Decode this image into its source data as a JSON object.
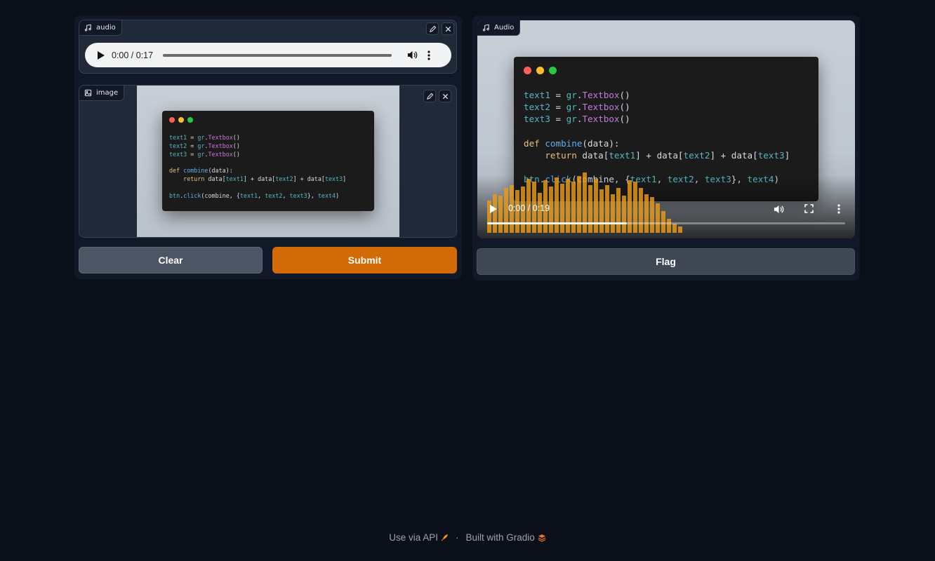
{
  "input_panel": {
    "audio": {
      "label": "audio",
      "time": "0:00 / 0:17"
    },
    "image": {
      "label": "image",
      "code_lines": [
        [
          {
            "t": "text1",
            "c": "var"
          },
          {
            "t": " = ",
            "c": "txt"
          },
          {
            "t": "gr",
            "c": "var"
          },
          {
            "t": ".",
            "c": "txt"
          },
          {
            "t": "Textbox",
            "c": "cls"
          },
          {
            "t": "()",
            "c": "txt"
          }
        ],
        [
          {
            "t": "text2",
            "c": "var"
          },
          {
            "t": " = ",
            "c": "txt"
          },
          {
            "t": "gr",
            "c": "var"
          },
          {
            "t": ".",
            "c": "txt"
          },
          {
            "t": "Textbox",
            "c": "cls"
          },
          {
            "t": "()",
            "c": "txt"
          }
        ],
        [
          {
            "t": "text3",
            "c": "var"
          },
          {
            "t": " = ",
            "c": "txt"
          },
          {
            "t": "gr",
            "c": "var"
          },
          {
            "t": ".",
            "c": "txt"
          },
          {
            "t": "Textbox",
            "c": "cls"
          },
          {
            "t": "()",
            "c": "txt"
          }
        ],
        [],
        [
          {
            "t": "def ",
            "c": "kw"
          },
          {
            "t": "combine",
            "c": "fn"
          },
          {
            "t": "(data):",
            "c": "txt"
          }
        ],
        [
          {
            "t": "    return ",
            "c": "kw"
          },
          {
            "t": "data[",
            "c": "txt"
          },
          {
            "t": "text1",
            "c": "var"
          },
          {
            "t": "] + ",
            "c": "txt"
          },
          {
            "t": "data[",
            "c": "txt"
          },
          {
            "t": "text2",
            "c": "var"
          },
          {
            "t": "] + ",
            "c": "txt"
          },
          {
            "t": "data[",
            "c": "txt"
          },
          {
            "t": "text3",
            "c": "var"
          },
          {
            "t": "]",
            "c": "txt"
          }
        ],
        [],
        [
          {
            "t": "btn",
            "c": "var"
          },
          {
            "t": ".",
            "c": "txt"
          },
          {
            "t": "click",
            "c": "fn"
          },
          {
            "t": "(combine, {",
            "c": "txt"
          },
          {
            "t": "text1",
            "c": "var"
          },
          {
            "t": ", ",
            "c": "txt"
          },
          {
            "t": "text2",
            "c": "var"
          },
          {
            "t": ", ",
            "c": "txt"
          },
          {
            "t": "text3",
            "c": "var"
          },
          {
            "t": "}, ",
            "c": "txt"
          },
          {
            "t": "text4",
            "c": "var"
          },
          {
            "t": ")",
            "c": "txt"
          }
        ]
      ]
    },
    "clear_label": "Clear",
    "submit_label": "Submit"
  },
  "output_panel": {
    "label": "Audio",
    "video_time": "0:00 / 0:19",
    "video_progress": 0.39,
    "code_lines": [
      [
        {
          "t": "text1",
          "c": "var"
        },
        {
          "t": " = ",
          "c": "txt"
        },
        {
          "t": "gr",
          "c": "var"
        },
        {
          "t": ".",
          "c": "txt"
        },
        {
          "t": "Textbox",
          "c": "cls"
        },
        {
          "t": "()",
          "c": "txt"
        }
      ],
      [
        {
          "t": "text2",
          "c": "var"
        },
        {
          "t": " = ",
          "c": "txt"
        },
        {
          "t": "gr",
          "c": "var"
        },
        {
          "t": ".",
          "c": "txt"
        },
        {
          "t": "Textbox",
          "c": "cls"
        },
        {
          "t": "()",
          "c": "txt"
        }
      ],
      [
        {
          "t": "text3",
          "c": "var"
        },
        {
          "t": " = ",
          "c": "txt"
        },
        {
          "t": "gr",
          "c": "var"
        },
        {
          "t": ".",
          "c": "txt"
        },
        {
          "t": "Textbox",
          "c": "cls"
        },
        {
          "t": "()",
          "c": "txt"
        }
      ],
      [],
      [
        {
          "t": "def ",
          "c": "kw"
        },
        {
          "t": "combine",
          "c": "fn"
        },
        {
          "t": "(data):",
          "c": "txt"
        }
      ],
      [
        {
          "t": "    return ",
          "c": "kw"
        },
        {
          "t": "data[",
          "c": "txt"
        },
        {
          "t": "text1",
          "c": "var"
        },
        {
          "t": "] + ",
          "c": "txt"
        },
        {
          "t": "data[",
          "c": "txt"
        },
        {
          "t": "text2",
          "c": "var"
        },
        {
          "t": "] + ",
          "c": "txt"
        },
        {
          "t": "data[",
          "c": "txt"
        },
        {
          "t": "text3",
          "c": "var"
        },
        {
          "t": "]",
          "c": "txt"
        }
      ],
      [],
      [
        {
          "t": "btn",
          "c": "var"
        },
        {
          "t": ".",
          "c": "txt"
        },
        {
          "t": "click",
          "c": "fn"
        },
        {
          "t": "(combine, {",
          "c": "txt"
        },
        {
          "t": "text1",
          "c": "var"
        },
        {
          "t": ", ",
          "c": "txt"
        },
        {
          "t": "text2",
          "c": "var"
        },
        {
          "t": ", ",
          "c": "txt"
        },
        {
          "t": "text3",
          "c": "var"
        },
        {
          "t": "}, ",
          "c": "txt"
        },
        {
          "t": "text4",
          "c": "var"
        },
        {
          "t": ")",
          "c": "txt"
        }
      ]
    ],
    "waveform_levels": [
      0.42,
      0.5,
      0.48,
      0.58,
      0.62,
      0.55,
      0.6,
      0.7,
      0.66,
      0.52,
      0.68,
      0.6,
      0.72,
      0.64,
      0.7,
      0.66,
      0.74,
      0.78,
      0.62,
      0.7,
      0.56,
      0.62,
      0.5,
      0.58,
      0.48,
      0.68,
      0.66,
      0.58,
      0.5,
      0.46,
      0.38,
      0.28,
      0.18,
      0.12,
      0.08
    ],
    "flag_label": "Flag"
  },
  "footer": {
    "api_label": "Use via API",
    "separator": "·",
    "built_label": "Built with Gradio"
  },
  "colors": {
    "background": "#0b0f19",
    "accent": "#d26a06",
    "waveform": "#ea9b16"
  },
  "icons": [
    "music-icon",
    "image-icon",
    "edit-icon",
    "close-icon",
    "play-icon",
    "volume-icon",
    "more-vert-icon",
    "fullscreen-icon",
    "rocket-icon",
    "gradio-logo-icon"
  ]
}
